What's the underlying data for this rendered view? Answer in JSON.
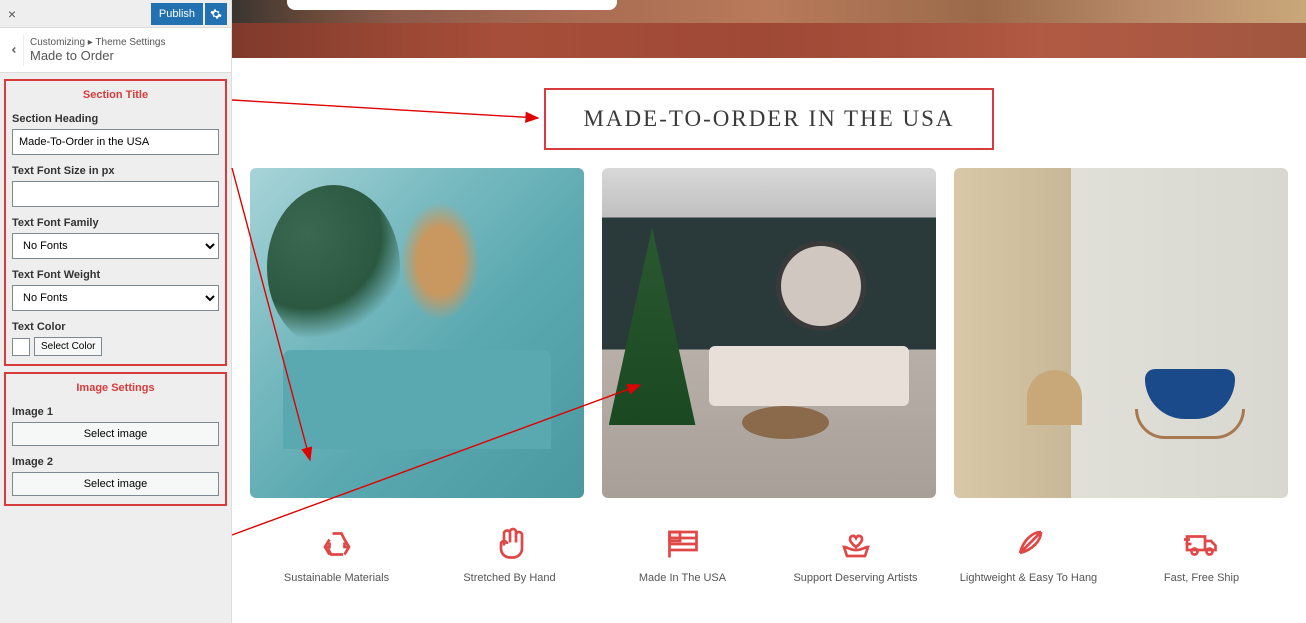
{
  "sidebar": {
    "publish_label": "Publish",
    "breadcrumb_prefix": "Customizing ▸ Theme Settings",
    "breadcrumb_title": "Made to Order"
  },
  "section_title_panel": {
    "title": "Section Title",
    "heading_label": "Section Heading",
    "heading_value": "Made-To-Order in the USA",
    "font_size_label": "Text Font Size in px",
    "font_size_value": "",
    "font_family_label": "Text Font Family",
    "font_family_selected": "No Fonts",
    "font_weight_label": "Text Font Weight",
    "font_weight_selected": "No Fonts",
    "text_color_label": "Text Color",
    "select_color_label": "Select Color"
  },
  "image_settings_panel": {
    "title": "Image Settings",
    "image1_label": "Image 1",
    "image2_label": "Image 2",
    "select_image_label": "Select image"
  },
  "preview": {
    "section_title": "MADE-TO-ORDER IN THE USA",
    "features": [
      {
        "label": "Sustainable Materials"
      },
      {
        "label": "Stretched By Hand"
      },
      {
        "label": "Made In The USA"
      },
      {
        "label": "Support Deserving Artists"
      },
      {
        "label": "Lightweight & Easy To Hang"
      },
      {
        "label": "Fast, Free Ship"
      }
    ]
  }
}
